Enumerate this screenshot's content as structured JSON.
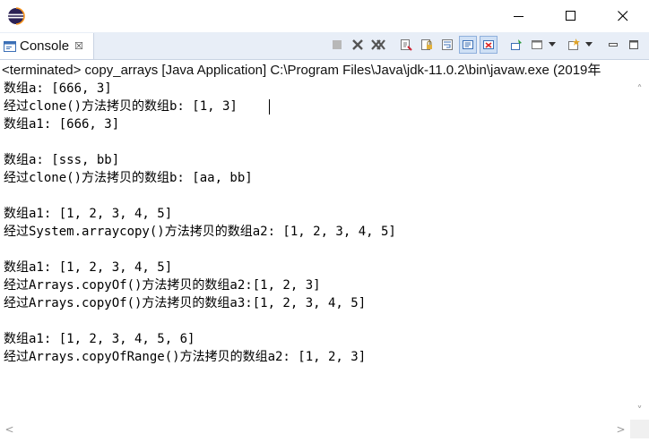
{
  "window": {
    "minimize_glyph": "—",
    "maximize_glyph": "□",
    "close_glyph": "✕"
  },
  "view_tab": {
    "label": "Console",
    "close_glyph": "☒",
    "icon": "console-icon"
  },
  "toolbar": {
    "icons": [
      "terminate-icon",
      "remove-launch-icon",
      "remove-all-terminated-icon",
      "clear-console-icon",
      "scroll-lock-icon",
      "word-wrap-icon",
      "show-on-stdout-icon",
      "show-on-stderr-icon",
      "pin-console-icon",
      "display-console-icon",
      "open-console-icon",
      "view-menu-icon",
      "minimize-view-icon",
      "maximize-view-icon"
    ]
  },
  "status": {
    "text": "<terminated> copy_arrays [Java Application] C:\\Program Files\\Java\\jdk-11.0.2\\bin\\javaw.exe (2019年"
  },
  "console": {
    "lines": [
      "数组a: [666, 3]",
      "经过clone()方法拷贝的数组b: [1, 3]",
      "数组a1: [666, 3]",
      "",
      "数组a: [sss, bb]",
      "经过clone()方法拷贝的数组b: [aa, bb]",
      "",
      "数组a1: [1, 2, 3, 4, 5]",
      "经过System.arraycopy()方法拷贝的数组a2: [1, 2, 3, 4, 5]",
      "",
      "数组a1: [1, 2, 3, 4, 5]",
      "经过Arrays.copyOf()方法拷贝的数组a2:[1, 2, 3]",
      "经过Arrays.copyOf()方法拷贝的数组a3:[1, 2, 3, 4, 5]",
      "",
      "数组a1: [1, 2, 3, 4, 5, 6]",
      "经过Arrays.copyOfRange()方法拷贝的数组a2: [1, 2, 3]"
    ]
  },
  "scrollbars": {
    "up_glyph": "˄",
    "down_glyph": "˅",
    "left_glyph": "<",
    "right_glyph": ">"
  },
  "colors": {
    "tab_bar_bg": "#e8eef7",
    "text": "#000000",
    "eclipse_purple": "#2c2255"
  }
}
